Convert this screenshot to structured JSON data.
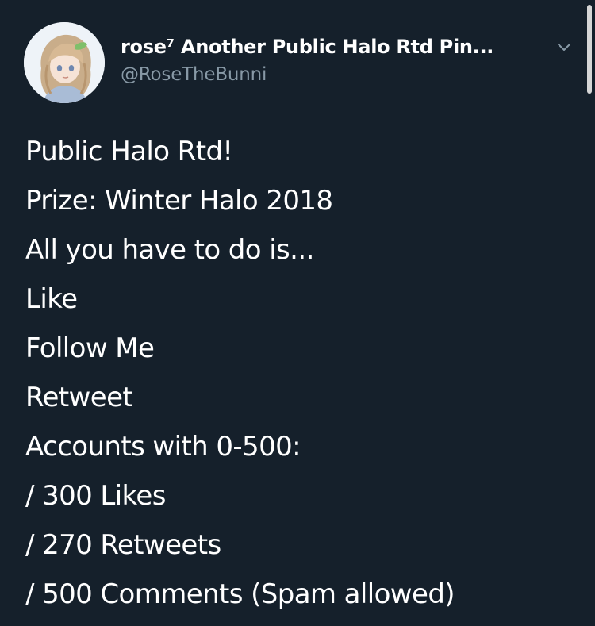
{
  "tweet": {
    "display_name": "rose⁷ Another Public Halo Rtd Pin...",
    "handle": "@RoseTheBunni",
    "lines": [
      "Public Halo Rtd!",
      "Prize: Winter Halo 2018",
      "All you have to do is...",
      "Like",
      "Follow Me",
      "Retweet",
      "Accounts with 0-500:",
      "/ 300 Likes",
      "/ 270 Retweets",
      "/ 500 Comments (Spam allowed)"
    ]
  },
  "icons": {
    "menu": "chevron-down-icon",
    "avatar": "avatar-image"
  },
  "colors": {
    "background": "#15202b",
    "text": "#ffffff",
    "secondary_text": "#8899a6",
    "scrollbar": "#d6d6d6"
  }
}
